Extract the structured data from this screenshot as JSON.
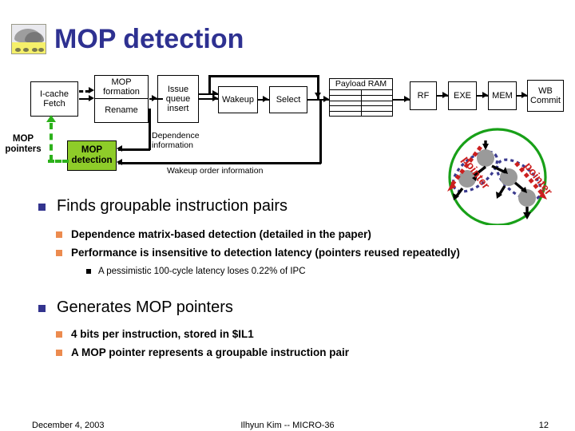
{
  "slide": {
    "title": "MOP detection",
    "title_icon": "picture-thumbnail-icon",
    "title_color": "#2e3191"
  },
  "diagram": {
    "pipeline_boxes": [
      {
        "id": "i-cache-fetch",
        "lines": [
          "I-cache",
          "Fetch"
        ]
      },
      {
        "id": "mop-formation",
        "lines": [
          "MOP",
          "formation"
        ]
      },
      {
        "id": "rename",
        "lines": [
          "Rename"
        ]
      },
      {
        "id": "issue-queue-insert",
        "lines": [
          "Issue",
          "queue",
          "insert"
        ]
      },
      {
        "id": "wakeup",
        "lines": [
          "Wakeup"
        ]
      },
      {
        "id": "select",
        "lines": [
          "Select"
        ]
      },
      {
        "id": "payload-ram",
        "lines": [
          "Payload RAM"
        ]
      },
      {
        "id": "rf",
        "lines": [
          "RF"
        ]
      },
      {
        "id": "exe",
        "lines": [
          "EXE"
        ]
      },
      {
        "id": "mem",
        "lines": [
          "MEM"
        ]
      },
      {
        "id": "wb-commit",
        "lines": [
          "WB",
          "Commit"
        ]
      }
    ],
    "mop_detection_box": {
      "line1": "MOP",
      "line2": "detection",
      "fill": "#8ecc29"
    },
    "labels": {
      "mop_pointers_1": "MOP",
      "mop_pointers_2": "pointers",
      "dependence_1": "Dependence",
      "dependence_2": "information",
      "wakeup_order": "Wakeup order information"
    },
    "circle_figure": {
      "pointer_left_label": "pointer",
      "pointer_right_label": "pointer",
      "circle_color": "#18a018",
      "node_color": "#9a9a9a",
      "loop_color": "#3b3b8f",
      "pointer_color": "#cc1f1f"
    }
  },
  "content": {
    "bullets": [
      {
        "text": "Finds groupable instruction pairs",
        "children": [
          {
            "text": "Dependence matrix-based detection (detailed in the paper)",
            "children": []
          },
          {
            "text": "Performance is insensitive to detection latency (pointers reused repeatedly)",
            "children": [
              {
                "text": "A pessimistic 100-cycle latency loses 0.22% of IPC"
              }
            ]
          }
        ]
      },
      {
        "text": "Generates MOP pointers",
        "children": [
          {
            "text": "4 bits per instruction, stored in $IL1",
            "children": []
          },
          {
            "text": "A MOP pointer represents a groupable instruction pair",
            "children": []
          }
        ]
      }
    ]
  },
  "footer": {
    "date": "December 4, 2003",
    "center": "Ilhyun Kim -- MICRO-36",
    "page_number": "12"
  }
}
